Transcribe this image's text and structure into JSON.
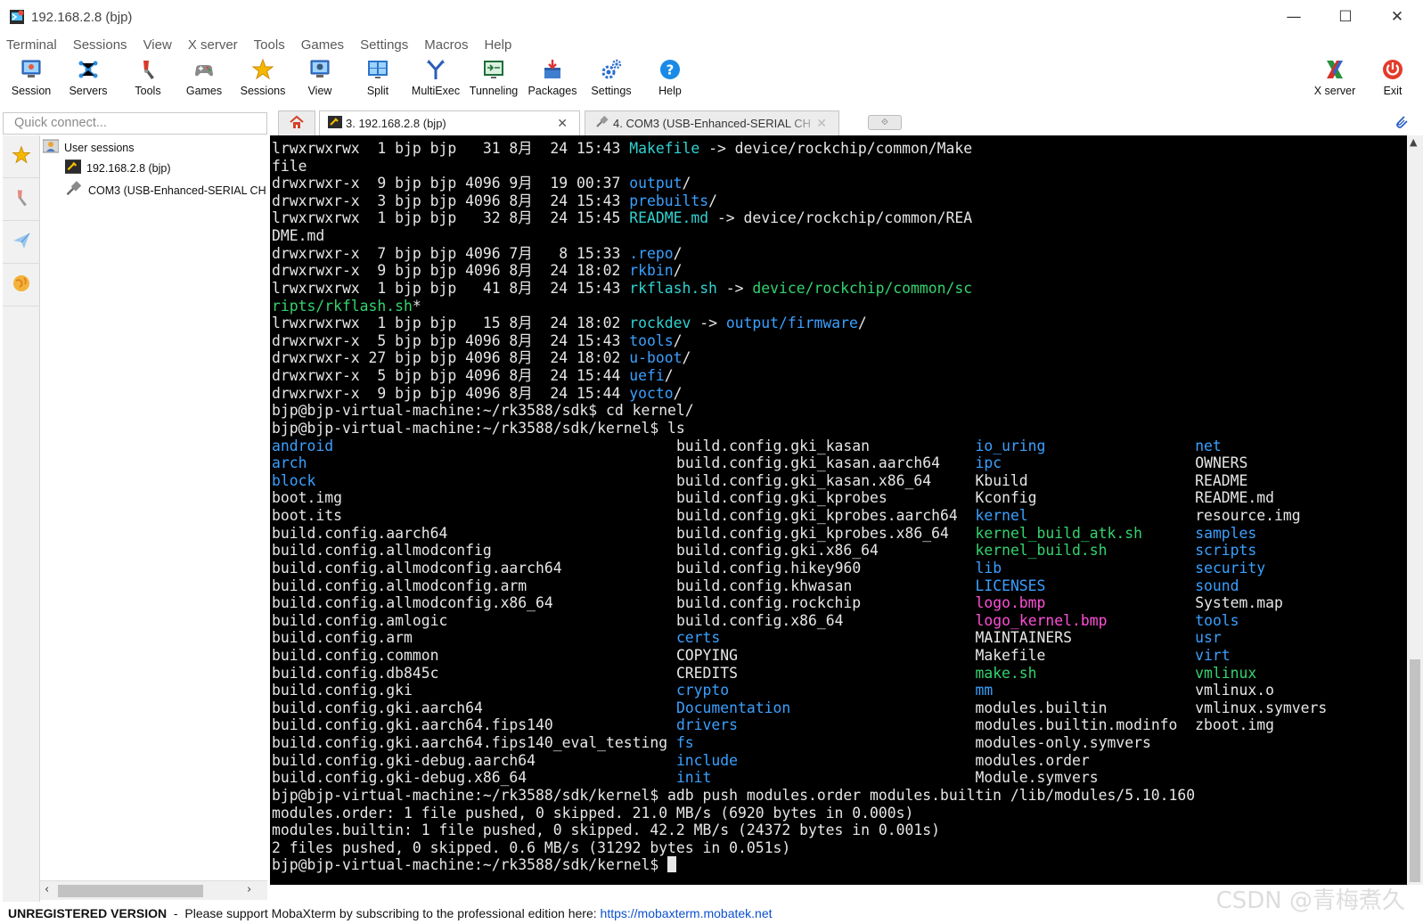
{
  "window": {
    "title": "192.168.2.8 (bjp)",
    "minimize": "—",
    "maximize": "☐",
    "close": "✕"
  },
  "menu": [
    "Terminal",
    "Sessions",
    "View",
    "X server",
    "Tools",
    "Games",
    "Settings",
    "Macros",
    "Help"
  ],
  "toolbar": {
    "session": "Session",
    "servers": "Servers",
    "tools": "Tools",
    "games": "Games",
    "sessions": "Sessions",
    "view": "View",
    "split": "Split",
    "multiexec": "MultiExec",
    "tunneling": "Tunneling",
    "packages": "Packages",
    "settings": "Settings",
    "help": "Help",
    "xserver": "X server",
    "exit": "Exit"
  },
  "quick_connect": {
    "placeholder": "Quick connect..."
  },
  "tabs": {
    "active": "3. 192.168.2.8 (bjp)",
    "inactive": "4. COM3  (USB-Enhanced-SERIAL CH",
    "close": "✕",
    "add": "⟐"
  },
  "tree": {
    "root": "User sessions",
    "items": [
      "192.168.2.8 (bjp)",
      "COM3  (USB-Enhanced-SERIAL CH"
    ]
  },
  "colors": {
    "dir": "#3aa0ff",
    "exec": "#33d36e",
    "link": "#32d2d2",
    "image": "#ff4fd8",
    "text": "#e6e6e6",
    "terminal_bg": "#000000"
  },
  "terminal": {
    "lines": [
      [
        {
          "t": "lrwxrwxrwx  1 bjp bjp   31 8月  24 15:43 "
        },
        {
          "t": "Makefile",
          "c": "link"
        },
        {
          "t": " -> device/rockchip/common/Make"
        }
      ],
      [
        {
          "t": "file"
        }
      ],
      [
        {
          "t": "drwxrwxr-x  9 bjp bjp 4096 9月  19 00:37 "
        },
        {
          "t": "output",
          "c": "dir"
        },
        {
          "t": "/"
        }
      ],
      [
        {
          "t": "drwxrwxr-x  3 bjp bjp 4096 8月  24 15:43 "
        },
        {
          "t": "prebuilts",
          "c": "dir"
        },
        {
          "t": "/"
        }
      ],
      [
        {
          "t": "lrwxrwxrwx  1 bjp bjp   32 8月  24 15:45 "
        },
        {
          "t": "README.md",
          "c": "link"
        },
        {
          "t": " -> device/rockchip/common/REA"
        }
      ],
      [
        {
          "t": "DME.md"
        }
      ],
      [
        {
          "t": "drwxrwxr-x  7 bjp bjp 4096 7月   8 15:33 "
        },
        {
          "t": ".repo",
          "c": "dir"
        },
        {
          "t": "/"
        }
      ],
      [
        {
          "t": "drwxrwxr-x  9 bjp bjp 4096 8月  24 18:02 "
        },
        {
          "t": "rkbin",
          "c": "dir"
        },
        {
          "t": "/"
        }
      ],
      [
        {
          "t": "lrwxrwxrwx  1 bjp bjp   41 8月  24 15:43 "
        },
        {
          "t": "rkflash.sh",
          "c": "link"
        },
        {
          "t": " -> "
        },
        {
          "t": "device/rockchip/common/sc",
          "c": "exec"
        }
      ],
      [
        {
          "t": "ripts/rkflash.sh",
          "c": "exec"
        },
        {
          "t": "*"
        }
      ],
      [
        {
          "t": "lrwxrwxrwx  1 bjp bjp   15 8月  24 18:02 "
        },
        {
          "t": "rockdev",
          "c": "link"
        },
        {
          "t": " -> "
        },
        {
          "t": "output/firmware",
          "c": "dir"
        },
        {
          "t": "/"
        }
      ],
      [
        {
          "t": "drwxrwxr-x  5 bjp bjp 4096 8月  24 15:43 "
        },
        {
          "t": "tools",
          "c": "dir"
        },
        {
          "t": "/"
        }
      ],
      [
        {
          "t": "drwxrwxr-x 27 bjp bjp 4096 8月  24 18:02 "
        },
        {
          "t": "u-boot",
          "c": "dir"
        },
        {
          "t": "/"
        }
      ],
      [
        {
          "t": "drwxrwxr-x  5 bjp bjp 4096 8月  24 15:44 "
        },
        {
          "t": "uefi",
          "c": "dir"
        },
        {
          "t": "/"
        }
      ],
      [
        {
          "t": "drwxrwxr-x  9 bjp bjp 4096 8月  24 15:44 "
        },
        {
          "t": "yocto",
          "c": "dir"
        },
        {
          "t": "/"
        }
      ],
      [
        {
          "t": "bjp@bjp-virtual-machine:~/rk3588/sdk$ cd kernel/"
        }
      ],
      [
        {
          "t": "bjp@bjp-virtual-machine:~/rk3588/sdk/kernel$ ls"
        }
      ],
      [
        {
          "t": "android",
          "c": "dir",
          "p": "                                              "
        },
        {
          "t": "build.config.gki_kasan",
          "p": "            "
        },
        {
          "t": "io_uring",
          "c": "dir",
          "p": "                "
        },
        {
          "t": "net",
          "c": "dir"
        }
      ],
      [
        {
          "t": "arch",
          "c": "dir",
          "p": "                                              "
        },
        {
          "t": "build.config.gki_kasan.aarch64",
          "p": "    "
        },
        {
          "t": "ipc",
          "c": "dir",
          "p": "                "
        },
        {
          "t": "OWNERS"
        }
      ],
      [
        {
          "t": "block",
          "c": "dir",
          "p": "                                              "
        },
        {
          "t": "build.config.gki_kasan.x86_64",
          "p": "     "
        },
        {
          "t": "Kbuild",
          "p": "                "
        },
        {
          "t": "README"
        }
      ],
      [
        {
          "t": "boot.img",
          "p": "                                              "
        },
        {
          "t": "build.config.gki_kprobes",
          "p": "          "
        },
        {
          "t": "Kconfig",
          "p": "                "
        },
        {
          "t": "README.md"
        }
      ],
      [
        {
          "t": "boot.its",
          "p": "                                              "
        },
        {
          "t": "build.config.gki_kprobes.aarch64",
          "p": "  "
        },
        {
          "t": "kernel",
          "c": "dir",
          "p": "                "
        },
        {
          "t": "resource.img"
        }
      ],
      [
        {
          "t": "build.config.aarch64",
          "p": "                                              "
        },
        {
          "t": "build.config.gki_kprobes.x86_64",
          "p": "   "
        },
        {
          "t": "kernel_build_atk.sh",
          "c": "exec",
          "p": "                "
        },
        {
          "t": "samples",
          "c": "dir"
        }
      ],
      [
        {
          "t": "build.config.allmodconfig",
          "p": "                                              "
        },
        {
          "t": "build.config.gki.x86_64",
          "p": "           "
        },
        {
          "t": "kernel_build.sh",
          "c": "exec",
          "p": "                "
        },
        {
          "t": "scripts",
          "c": "dir"
        }
      ],
      [
        {
          "t": "build.config.allmodconfig.aarch64",
          "p": "                                              "
        },
        {
          "t": "build.config.hikey960",
          "p": "             "
        },
        {
          "t": "lib",
          "c": "dir",
          "p": "                "
        },
        {
          "t": "security",
          "c": "dir"
        }
      ],
      [
        {
          "t": "build.config.allmodconfig.arm",
          "p": "                                              "
        },
        {
          "t": "build.config.khwasan",
          "p": "              "
        },
        {
          "t": "LICENSES",
          "c": "dir",
          "p": "                "
        },
        {
          "t": "sound",
          "c": "dir"
        }
      ],
      [
        {
          "t": "build.config.allmodconfig.x86_64",
          "p": "                                              "
        },
        {
          "t": "build.config.rockchip",
          "p": "             "
        },
        {
          "t": "logo.bmp",
          "c": "image",
          "p": "                "
        },
        {
          "t": "System.map"
        }
      ],
      [
        {
          "t": "build.config.amlogic",
          "p": "                                              "
        },
        {
          "t": "build.config.x86_64",
          "p": "               "
        },
        {
          "t": "logo_kernel.bmp",
          "c": "image",
          "p": "                "
        },
        {
          "t": "tools",
          "c": "dir"
        }
      ],
      [
        {
          "t": "build.config.arm",
          "p": "                                              "
        },
        {
          "t": "certs",
          "c": "dir",
          "p": "                             "
        },
        {
          "t": "MAINTAINERS",
          "p": "                "
        },
        {
          "t": "usr",
          "c": "dir"
        }
      ],
      [
        {
          "t": "build.config.common",
          "p": "                                              "
        },
        {
          "t": "COPYING",
          "p": "                           "
        },
        {
          "t": "Makefile",
          "p": "                "
        },
        {
          "t": "virt",
          "c": "dir"
        }
      ],
      [
        {
          "t": "build.config.db845c",
          "p": "                                              "
        },
        {
          "t": "CREDITS",
          "p": "                           "
        },
        {
          "t": "make.sh",
          "c": "exec",
          "p": "                "
        },
        {
          "t": "vmlinux",
          "c": "exec"
        }
      ],
      [
        {
          "t": "build.config.gki",
          "p": "                                              "
        },
        {
          "t": "crypto",
          "c": "dir",
          "p": "                            "
        },
        {
          "t": "mm",
          "c": "dir",
          "p": "                "
        },
        {
          "t": "vmlinux.o"
        }
      ],
      [
        {
          "t": "build.config.gki.aarch64",
          "p": "                                              "
        },
        {
          "t": "Documentation",
          "c": "dir",
          "p": "                     "
        },
        {
          "t": "modules.builtin",
          "p": "                "
        },
        {
          "t": "vmlinux.symvers"
        }
      ],
      [
        {
          "t": "build.config.gki.aarch64.fips140",
          "p": "                                              "
        },
        {
          "t": "drivers",
          "c": "dir",
          "p": "                           "
        },
        {
          "t": "modules.builtin.modinfo",
          "p": "                "
        },
        {
          "t": "zboot.img"
        }
      ],
      [
        {
          "t": "build.config.gki.aarch64.fips140_eval_testing",
          "p": "                                              "
        },
        {
          "t": "fs",
          "c": "dir",
          "p": "                                "
        },
        {
          "t": "modules-only.symvers"
        }
      ],
      [
        {
          "t": "build.config.gki-debug.aarch64",
          "p": "                                              "
        },
        {
          "t": "include",
          "c": "dir",
          "p": "                           "
        },
        {
          "t": "modules.order"
        }
      ],
      [
        {
          "t": "build.config.gki-debug.x86_64",
          "p": "                                              "
        },
        {
          "t": "init",
          "c": "dir",
          "p": "                              "
        },
        {
          "t": "Module.symvers"
        }
      ],
      [
        {
          "t": "bjp@bjp-virtual-machine:~/rk3588/sdk/kernel$ adb push modules.order modules.builtin /lib/modules/5.10.160"
        }
      ],
      [
        {
          "t": "modules.order: 1 file pushed, 0 skipped. 21.0 MB/s (6920 bytes in 0.000s)"
        }
      ],
      [
        {
          "t": "modules.builtin: 1 file pushed, 0 skipped. 42.2 MB/s (24372 bytes in 0.001s)"
        }
      ],
      [
        {
          "t": "2 files pushed, 0 skipped. 0.6 MB/s (31292 bytes in 0.051s)"
        }
      ],
      [
        {
          "t": "bjp@bjp-virtual-machine:~/rk3588/sdk/kernel$ "
        }
      ]
    ]
  },
  "status": {
    "unregistered": "UNREGISTERED VERSION",
    "sep": "  -  ",
    "message": "Please support MobaXterm by subscribing to the professional edition here: ",
    "link": "https://mobaxterm.mobatek.net"
  },
  "watermark": "CSDN @青梅煮久"
}
